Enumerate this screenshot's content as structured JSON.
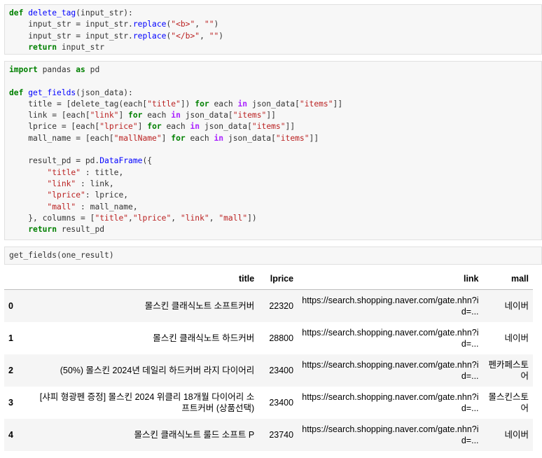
{
  "cells": {
    "cell1": {
      "lines": [
        [
          [
            "kw",
            "def "
          ],
          [
            "fn",
            "delete_tag"
          ],
          [
            "plain",
            "(input_str):"
          ]
        ],
        [
          [
            "plain",
            "    input_str = input_str."
          ],
          [
            "fn",
            "replace"
          ],
          [
            "plain",
            "("
          ],
          [
            "st",
            "\"<b>\""
          ],
          [
            "plain",
            ", "
          ],
          [
            "st",
            "\"\""
          ],
          [
            "plain",
            ")"
          ]
        ],
        [
          [
            "plain",
            "    input_str = input_str."
          ],
          [
            "fn",
            "replace"
          ],
          [
            "plain",
            "("
          ],
          [
            "st",
            "\"</b>\""
          ],
          [
            "plain",
            ", "
          ],
          [
            "st",
            "\"\""
          ],
          [
            "plain",
            ")"
          ]
        ],
        [
          [
            "plain",
            "    "
          ],
          [
            "kw",
            "return"
          ],
          [
            "plain",
            " input_str"
          ]
        ]
      ]
    },
    "cell2": {
      "lines": [
        [
          [
            "kw",
            "import"
          ],
          [
            "plain",
            " pandas "
          ],
          [
            "kw",
            "as"
          ],
          [
            "plain",
            " pd"
          ]
        ],
        [
          [
            "plain",
            ""
          ]
        ],
        [
          [
            "kw",
            "def "
          ],
          [
            "fn",
            "get_fields"
          ],
          [
            "plain",
            "(json_data):"
          ]
        ],
        [
          [
            "plain",
            "    title = [delete_tag(each["
          ],
          [
            "st",
            "\"title\""
          ],
          [
            "plain",
            "]) "
          ],
          [
            "kw",
            "for"
          ],
          [
            "plain",
            " each "
          ],
          [
            "op",
            "in"
          ],
          [
            "plain",
            " json_data["
          ],
          [
            "st",
            "\"items\""
          ],
          [
            "plain",
            "]]"
          ]
        ],
        [
          [
            "plain",
            "    link = [each["
          ],
          [
            "st",
            "\"link\""
          ],
          [
            "plain",
            "] "
          ],
          [
            "kw",
            "for"
          ],
          [
            "plain",
            " each "
          ],
          [
            "op",
            "in"
          ],
          [
            "plain",
            " json_data["
          ],
          [
            "st",
            "\"items\""
          ],
          [
            "plain",
            "]]"
          ]
        ],
        [
          [
            "plain",
            "    lprice = [each["
          ],
          [
            "st",
            "\"lprice\""
          ],
          [
            "plain",
            "] "
          ],
          [
            "kw",
            "for"
          ],
          [
            "plain",
            " each "
          ],
          [
            "op",
            "in"
          ],
          [
            "plain",
            " json_data["
          ],
          [
            "st",
            "\"items\""
          ],
          [
            "plain",
            "]]"
          ]
        ],
        [
          [
            "plain",
            "    mall_name = [each["
          ],
          [
            "st",
            "\"mallName\""
          ],
          [
            "plain",
            "] "
          ],
          [
            "kw",
            "for"
          ],
          [
            "plain",
            " each "
          ],
          [
            "op",
            "in"
          ],
          [
            "plain",
            " json_data["
          ],
          [
            "st",
            "\"items\""
          ],
          [
            "plain",
            "]]"
          ]
        ],
        [
          [
            "plain",
            ""
          ]
        ],
        [
          [
            "plain",
            "    result_pd = pd."
          ],
          [
            "fn",
            "DataFrame"
          ],
          [
            "plain",
            "({"
          ]
        ],
        [
          [
            "plain",
            "        "
          ],
          [
            "st",
            "\"title\""
          ],
          [
            "plain",
            " : title,"
          ]
        ],
        [
          [
            "plain",
            "        "
          ],
          [
            "st",
            "\"link\""
          ],
          [
            "plain",
            " : link,"
          ]
        ],
        [
          [
            "plain",
            "        "
          ],
          [
            "st",
            "\"lprice\""
          ],
          [
            "plain",
            ": lprice,"
          ]
        ],
        [
          [
            "plain",
            "        "
          ],
          [
            "st",
            "\"mall\""
          ],
          [
            "plain",
            " : mall_name,"
          ]
        ],
        [
          [
            "plain",
            "    }, columns = ["
          ],
          [
            "st",
            "\"title\""
          ],
          [
            "plain",
            ","
          ],
          [
            "st",
            "\"lprice\""
          ],
          [
            "plain",
            ", "
          ],
          [
            "st",
            "\"link\""
          ],
          [
            "plain",
            ", "
          ],
          [
            "st",
            "\"mall\""
          ],
          [
            "plain",
            "])"
          ]
        ],
        [
          [
            "plain",
            "    "
          ],
          [
            "kw",
            "return"
          ],
          [
            "plain",
            " result_pd"
          ]
        ]
      ]
    },
    "cell3": {
      "lines": [
        [
          [
            "plain",
            "get_fields(one_result)"
          ]
        ]
      ]
    }
  },
  "dataframe": {
    "columns": [
      "title",
      "lprice",
      "link",
      "mall"
    ],
    "rows": [
      {
        "index": "0",
        "title": "몰스킨 클래식노트 소프트커버",
        "lprice": "22320",
        "link": "https://search.shopping.naver.com/gate.nhn?id=...",
        "mall": "네이버"
      },
      {
        "index": "1",
        "title": "몰스킨 클래식노트 하드커버",
        "lprice": "28800",
        "link": "https://search.shopping.naver.com/gate.nhn?id=...",
        "mall": "네이버"
      },
      {
        "index": "2",
        "title": "(50%) 몰스킨 2024년 데일리 하드커버 라지 다이어리",
        "lprice": "23400",
        "link": "https://search.shopping.naver.com/gate.nhn?id=...",
        "mall": "펜카페스토어"
      },
      {
        "index": "3",
        "title": "[샤피 형광펜 증정] 몰스킨 2024 위클리 18개월 다이어리 소프트커버 (상품선택)",
        "lprice": "23400",
        "link": "https://search.shopping.naver.com/gate.nhn?id=...",
        "mall": "몰스킨스토어"
      },
      {
        "index": "4",
        "title": "몰스킨 클래식노트 룰드 소프트 P",
        "lprice": "23740",
        "link": "https://search.shopping.naver.com/gate.nhn?id=...",
        "mall": "네이버"
      }
    ]
  }
}
